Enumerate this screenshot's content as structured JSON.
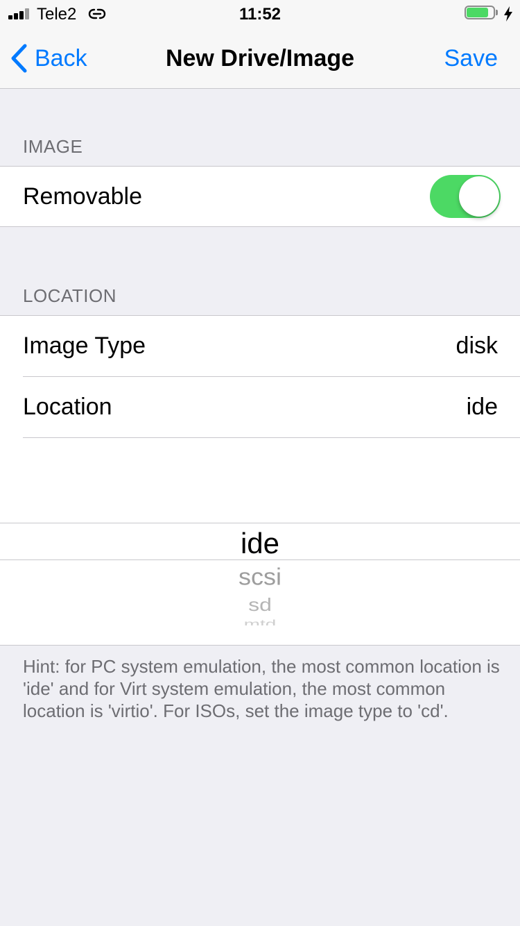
{
  "status_bar": {
    "carrier": "Tele2",
    "time": "11:52",
    "battery_level": 0.85,
    "battery_color": "#4CD964",
    "icons": [
      "signal-icon",
      "link-icon",
      "battery-icon",
      "charging-bolt-icon"
    ]
  },
  "nav": {
    "back_label": "Back",
    "title": "New Drive/Image",
    "save_label": "Save",
    "accent_color": "#007AFF"
  },
  "sections": {
    "image": {
      "header": "IMAGE",
      "removable_label": "Removable",
      "removable_on": true
    },
    "location": {
      "header": "LOCATION",
      "image_type_label": "Image Type",
      "image_type_value": "disk",
      "location_label": "Location",
      "location_value": "ide"
    }
  },
  "picker": {
    "selected": "ide",
    "options": [
      "ide",
      "scsi",
      "sd",
      "mtd"
    ]
  },
  "hint": "Hint: for PC system emulation, the most common location is 'ide' and for Virt system emulation, the most common location is 'virtio'. For ISOs, set the image type to 'cd'."
}
